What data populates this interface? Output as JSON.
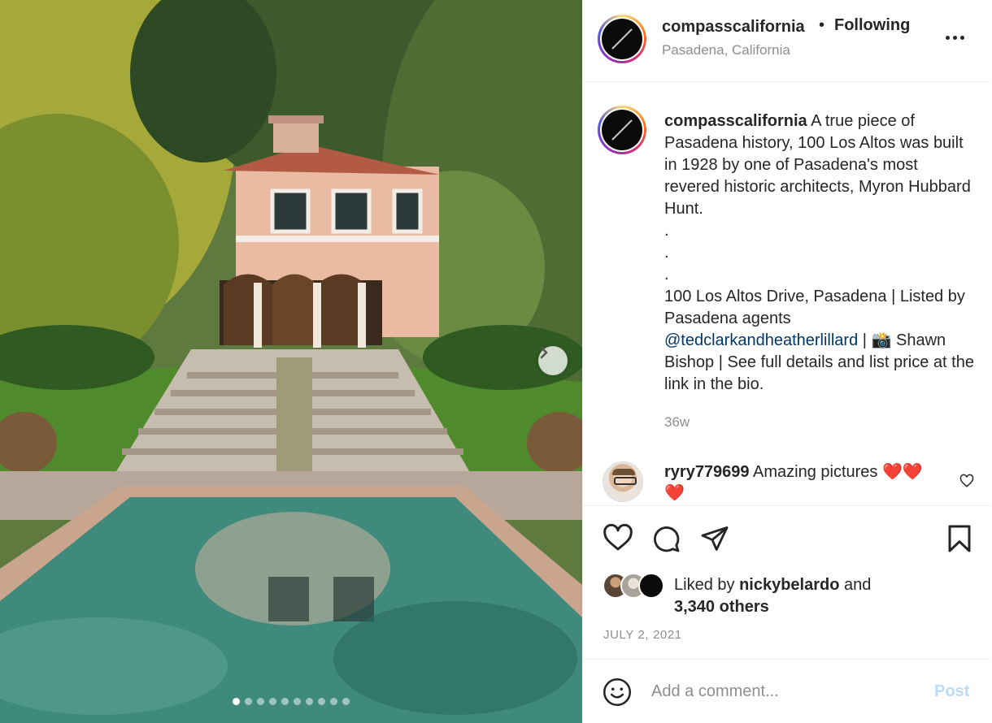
{
  "header": {
    "username": "compasscalifornia",
    "separator": "•",
    "follow_label": "Following",
    "location": "Pasadena, California"
  },
  "caption": {
    "username": "compasscalifornia",
    "text_part1": "A true piece of Pasadena history, 100 Los Altos was built in 1928 by one of Pasadena's most revered historic architects, Myron Hubbard Hunt.",
    "dots": [
      ".",
      ".",
      "."
    ],
    "text_part2": "100 Los Altos Drive, Pasadena | Listed by Pasadena agents",
    "mention": "@tedclarkandheatherlillard",
    "text_part3": "| 📸 Shawn Bishop | See full details and list price at the link in the bio.",
    "time": "36w"
  },
  "comment": {
    "username": "ryry779699",
    "text": "Amazing pictures ❤️❤️❤️"
  },
  "likes": {
    "prefix": "Liked by",
    "user": "nickybelardo",
    "and": "and",
    "others": "3,340 others"
  },
  "date": "JULY 2, 2021",
  "comment_input": {
    "placeholder": "Add a comment...",
    "post_label": "Post"
  },
  "carousel": {
    "slide_count": 10,
    "active_index": 0
  },
  "colors": {
    "link": "#00376b",
    "muted": "#8e8e8e",
    "post_disabled": "#b8dafb"
  }
}
